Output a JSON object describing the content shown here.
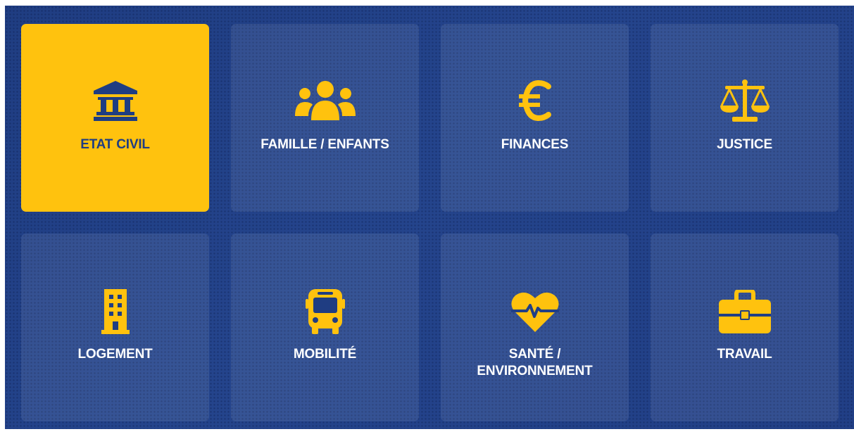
{
  "colors": {
    "background": "#213f85",
    "tile_active": "#ffc20e",
    "icon_yellow": "#ffc20e",
    "label_text": "#ffffff",
    "active_label_text": "#1f3d82"
  },
  "tiles": [
    {
      "label": "ETAT CIVIL",
      "icon": "bank-icon",
      "active": true
    },
    {
      "label": "FAMILLE / ENFANTS",
      "icon": "users-icon",
      "active": false
    },
    {
      "label": "FINANCES",
      "icon": "euro-icon",
      "active": false
    },
    {
      "label": "JUSTICE",
      "icon": "balance-scale-icon",
      "active": false
    },
    {
      "label": "LOGEMENT",
      "icon": "building-icon",
      "active": false
    },
    {
      "label": "MOBILITÉ",
      "icon": "bus-icon",
      "active": false
    },
    {
      "label_line1": "SANTÉ /",
      "label_line2": "ENVIRONNEMENT",
      "icon": "heartbeat-icon",
      "active": false
    },
    {
      "label": "TRAVAIL",
      "icon": "briefcase-icon",
      "active": false
    }
  ]
}
